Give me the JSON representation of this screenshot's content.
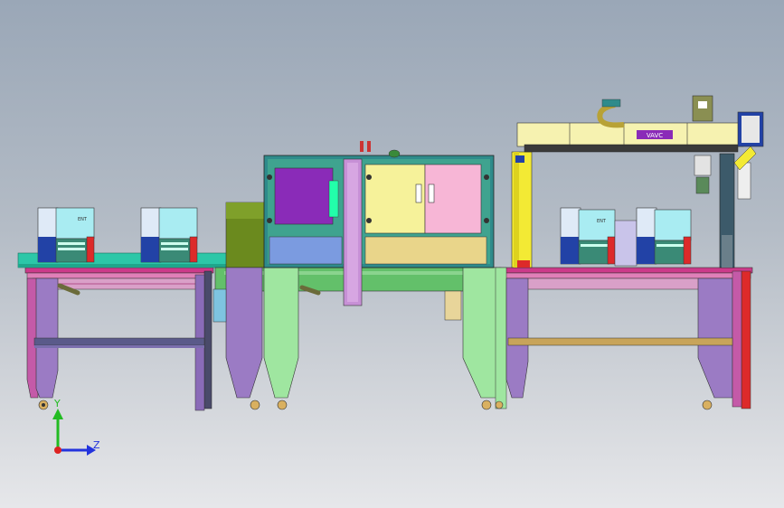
{
  "window": {
    "title": ""
  },
  "viewport": {
    "background_top": "#9aa7b7",
    "background_bottom": "#e6e7ea"
  },
  "triad": {
    "y_label": "Y",
    "z_label": "Z",
    "y_color": "#22bb22",
    "z_color": "#2233dd",
    "x_color": "#dd2222"
  },
  "conveyor": {
    "badge_text": "VAVC",
    "panel_color": "#f3f0a8",
    "frame_colors": [
      "#9b7bc4",
      "#8a6bb8",
      "#9fe6a0",
      "#2e8b8b"
    ]
  },
  "printer": {
    "left_label": "ENT",
    "right_label": "ENT"
  }
}
